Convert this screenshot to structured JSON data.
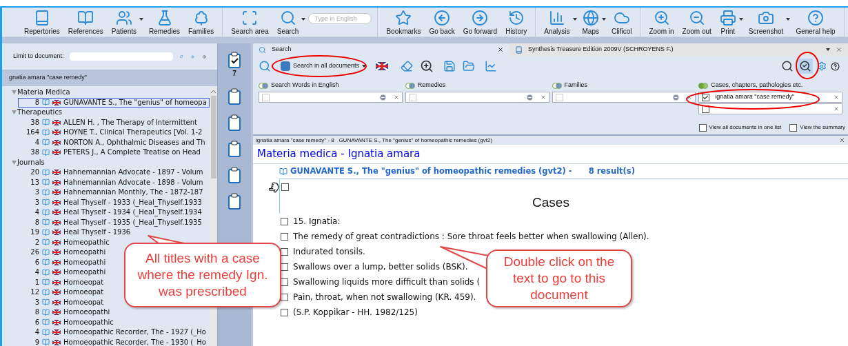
{
  "toolbar": {
    "groups": [
      {
        "buttons": [
          {
            "label": "Repertories",
            "dropdown": false
          },
          {
            "label": "References",
            "dropdown": false
          },
          {
            "label": "Patients",
            "dropdown": true
          },
          {
            "label": "Remedies",
            "dropdown": false
          },
          {
            "label": "Families",
            "dropdown": false
          }
        ]
      },
      {
        "buttons": [
          {
            "label": "Search area",
            "dropdown": false
          },
          {
            "label": "Search",
            "dropdown": true
          }
        ],
        "search_placeholder": "Type in English"
      },
      {
        "buttons": [
          {
            "label": "Bookmarks",
            "dropdown": false
          },
          {
            "label": "Go back",
            "dropdown": false
          },
          {
            "label": "Go forward",
            "dropdown": false
          },
          {
            "label": "History",
            "dropdown": false
          }
        ]
      },
      {
        "buttons": [
          {
            "label": "Analysis",
            "dropdown": true
          },
          {
            "label": "Maps",
            "dropdown": true
          },
          {
            "label": "Clificol",
            "dropdown": false
          }
        ]
      },
      {
        "buttons": [
          {
            "label": "Zoom in",
            "dropdown": false
          },
          {
            "label": "Zoom out",
            "dropdown": false
          },
          {
            "label": "Print",
            "dropdown": true
          },
          {
            "label": "Screenshot",
            "dropdown": true
          },
          {
            "label": "General help",
            "dropdown": false
          }
        ]
      }
    ]
  },
  "left_panel": {
    "limit_label": "Limit to document:",
    "query": "gnatia amara \"case remedy\"",
    "tree": [
      {
        "label": "Materia Medica",
        "expanded": true,
        "children": [
          {
            "count": "8",
            "title": "GUNAVANTE S., The \"genius\" of homeopa",
            "selected": true
          }
        ]
      },
      {
        "label": "Therapeutics",
        "expanded": true,
        "children": [
          {
            "count": "38",
            "title": "ALLEN H. , The Therapy of Intermittent",
            "selected": false
          },
          {
            "count": "164",
            "title": "HOYNE T., Clinical Therapeutics [Vol. 1-2",
            "selected": false
          },
          {
            "count": "4",
            "title": "NORTON A., Ophthalmic Diseases and Th",
            "selected": false
          },
          {
            "count": "38",
            "title": "PETERS J., A Complete Treatise on Head",
            "selected": false
          }
        ]
      },
      {
        "label": "Journals",
        "expanded": true,
        "children": [
          {
            "count": "20",
            "title": "Hahnemannian Advocate - 1897 - Volum",
            "selected": false
          },
          {
            "count": "13",
            "title": "Hahnemannian Advocate - 1898 - Volum",
            "selected": false
          },
          {
            "count": "3",
            "title": "Hahnemannian Monthly, The - 1872-187",
            "selected": false
          },
          {
            "count": "3",
            "title": "Heal Thyself - 1933 (_Heal_Thyself.1933",
            "selected": false
          },
          {
            "count": "4",
            "title": "Heal Thyself - 1934 (_Heal_Thyself.1934",
            "selected": false
          },
          {
            "count": "8",
            "title": "Heal Thyself - 1935 (_Heal_Thyself.1935",
            "selected": false
          },
          {
            "count": "19",
            "title": "Heal Thyself - 1936",
            "selected": false
          },
          {
            "count": "2",
            "title": "Homeopathic",
            "selected": false
          },
          {
            "count": "26",
            "title": "Homeopathi",
            "selected": false
          },
          {
            "count": "6",
            "title": "Homeopathi",
            "selected": false
          },
          {
            "count": "4",
            "title": "Homeopathi",
            "selected": false
          },
          {
            "count": "1",
            "title": "Homoeopat",
            "selected": false
          },
          {
            "count": "12",
            "title": "Homoeopat",
            "selected": false
          },
          {
            "count": "3",
            "title": "Homoeopat",
            "selected": false
          },
          {
            "count": "8",
            "title": "Homoeopathi",
            "selected": false
          },
          {
            "count": "6",
            "title": "Homoeopathic",
            "selected": false
          },
          {
            "count": "4",
            "title": "Homoeopathic Recorder, The - 1927 (_Ho",
            "selected": false
          },
          {
            "count": "9",
            "title": "Homoeopathic Recorder, The - 1930 (_Ho",
            "selected": false
          }
        ]
      }
    ]
  },
  "clipboards": [
    {
      "checked": true,
      "count": "7"
    },
    {
      "checked": false
    },
    {
      "checked": false
    },
    {
      "checked": false
    },
    {
      "checked": false
    },
    {
      "checked": false
    }
  ],
  "tabs": [
    {
      "label": "Search",
      "selected": true
    },
    {
      "label": "Synthesis Treasure Edition 2009V (SCHROYENS F.)",
      "selected": false
    }
  ],
  "search": {
    "scope": "Search in all documents",
    "fields": [
      {
        "label": "Search Words in English",
        "checked": false
      },
      {
        "label": "Remedies",
        "checked": false
      },
      {
        "label": "Families",
        "checked": false
      },
      {
        "label": "Cases, chapters, pathologies etc.",
        "value": "ignatia amara \"case remedy\"",
        "checked": true
      }
    ],
    "blank_row": {
      "checked": false
    },
    "options": [
      {
        "label": "View all documents in one list",
        "checked": false
      },
      {
        "label": "View the summary",
        "checked": false
      }
    ]
  },
  "result": {
    "breadcrumb": "ignatia amara \"case remedy\" - 8   GUNAVANTE S., The \"genius\" of homeopathic remedies (gvt2)",
    "heading": "Materia medica - Ignatia amara",
    "source": "GUNAVANTE S., The \"genius\" of homeopathic remedies (gvt2) -",
    "count": "8 result(s)",
    "section": "Cases",
    "section_checked": false,
    "lines": [
      {
        "text": "15. Ignatia:",
        "checked": false
      },
      {
        "text": "The remedy of great contradictions : Sore throat feels better when swallowing (Allen).",
        "checked": false
      },
      {
        "text": "Indurated tonsils.",
        "checked": false
      },
      {
        "text": "Swallows over a lump, better solids (BSK).",
        "checked": false
      },
      {
        "text": "Swallowing liquids more difficult than solids (",
        "checked": false
      },
      {
        "text": "Pain, throat, when not swallowing (KR. 459).",
        "checked": false
      },
      {
        "text": "(S.P. Koppikar - HH. 1982/125)",
        "checked": false
      }
    ]
  },
  "callouts": [
    "All titles with a case where the remedy Ign. was prescribed",
    "Double click on the text to go to this document"
  ]
}
